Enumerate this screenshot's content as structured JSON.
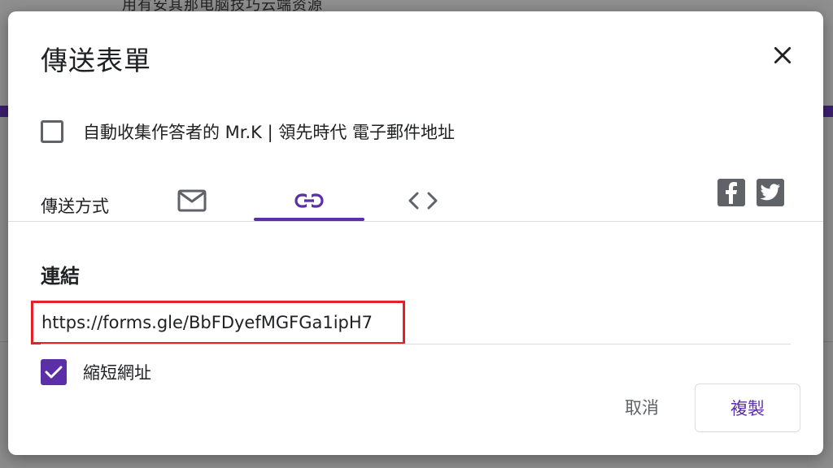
{
  "background": {
    "topbar_text": "用有安其那电脑技巧云端资源"
  },
  "dialog": {
    "title": "傳送表單",
    "collect_email": {
      "label": "自動收集作答者的 Mr.K | 領先時代 電子郵件地址",
      "checked": false
    },
    "send_via": {
      "label": "傳送方式",
      "tabs": [
        {
          "name": "email",
          "icon": "mail-icon",
          "selected": false
        },
        {
          "name": "link",
          "icon": "link-icon",
          "selected": true
        },
        {
          "name": "embed",
          "icon": "code-icon",
          "selected": false
        }
      ],
      "social": [
        "facebook-icon",
        "twitter-icon"
      ]
    },
    "link_section": {
      "title": "連結",
      "url": "https://forms.gle/BbFDyefMGFGa1ipH7",
      "shorten_label": "縮短網址",
      "shorten_checked": true
    },
    "buttons": {
      "cancel": "取消",
      "copy": "複製"
    }
  },
  "colors": {
    "accent": "#5b2fa6",
    "highlight_border": "#e8202a",
    "text_primary": "#202124",
    "text_secondary": "#5f6368"
  }
}
